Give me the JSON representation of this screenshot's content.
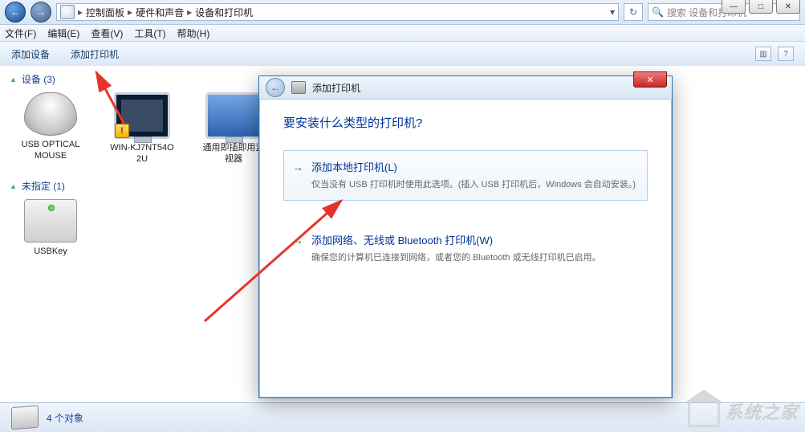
{
  "window_buttons": {
    "min": "—",
    "max": "□",
    "close": "✕"
  },
  "nav": {
    "back": "←",
    "fwd": "→"
  },
  "breadcrumb": {
    "root": "控制面板",
    "sep": "▸",
    "l1": "硬件和声音",
    "l2": "设备和打印机",
    "drop": "▾",
    "reload": "↻"
  },
  "search": {
    "placeholder": "搜索 设备和打印机",
    "mag": "🔍"
  },
  "menu": {
    "file": "文件(F)",
    "edit": "编辑(E)",
    "view": "查看(V)",
    "tools": "工具(T)",
    "help": "帮助(H)"
  },
  "toolbar": {
    "add_device": "添加设备",
    "add_printer": "添加打印机"
  },
  "groups": {
    "devices": {
      "head": "设备 (3)",
      "tri": "▲",
      "items": [
        {
          "label": "USB OPTICAL MOUSE"
        },
        {
          "label": "WIN-KJ7NT54O\n2U",
          "warn": "!"
        },
        {
          "label": "通用即插即用监视器"
        }
      ]
    },
    "unspecified": {
      "head": "未指定 (1)",
      "tri": "▲",
      "items": [
        {
          "label": "USBKey"
        }
      ]
    }
  },
  "status": {
    "count": "4 个对象"
  },
  "dialog": {
    "title": "添加打印机",
    "close": "✕",
    "heading": "要安装什么类型的打印机?",
    "opt1": {
      "arrow": "→",
      "title": "添加本地打印机(L)",
      "desc": "仅当没有 USB 打印机时使用此选项。(插入 USB 打印机后，Windows 会自动安装。)"
    },
    "opt2": {
      "arrow": "→",
      "title": "添加网络、无线或 Bluetooth 打印机(W)",
      "desc": "确保您的计算机已连接到网络，或者您的 Bluetooth 或无线打印机已启用。"
    }
  },
  "watermark": "系统之家"
}
